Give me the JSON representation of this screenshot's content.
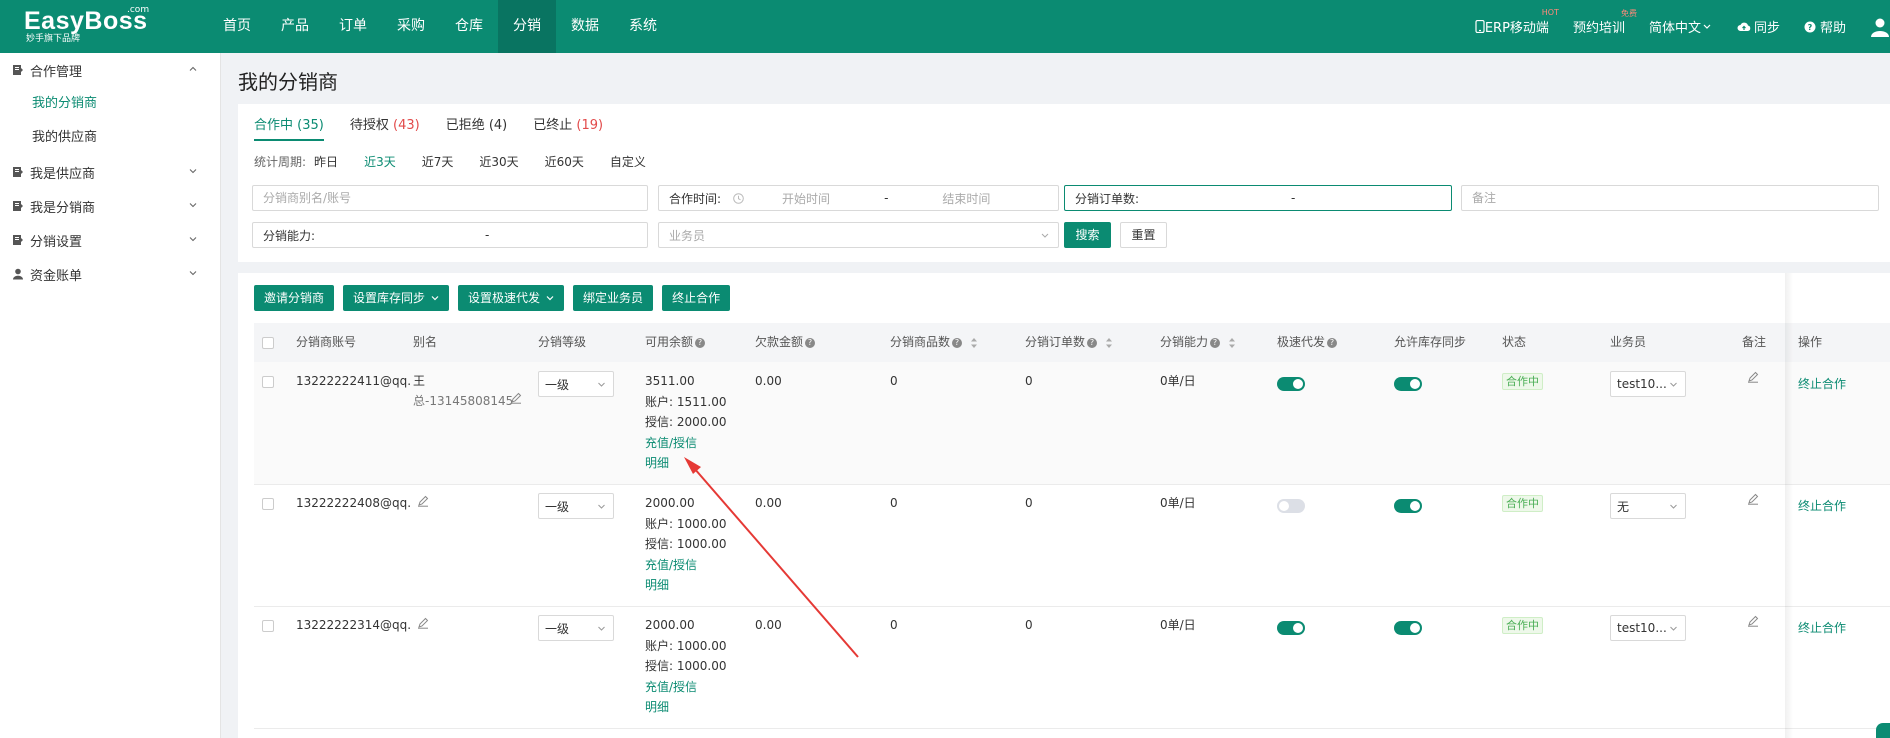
{
  "app": {
    "logo": "EasyBoss",
    "logo_com": ".com",
    "slogan": "妙手旗下品牌",
    "accent": "#0b8b72"
  },
  "nav": [
    "首页",
    "产品",
    "订单",
    "采购",
    "仓库",
    "分销",
    "数据",
    "系统"
  ],
  "nav_active": "分销",
  "topright": {
    "erp": "ERP移动端",
    "hot": "HOT",
    "training": "预约培训",
    "free": "免费",
    "language": "简体中文",
    "sync": "同步",
    "help": "帮助"
  },
  "sidebar": {
    "groups": [
      {
        "label": "合作管理",
        "expanded": true,
        "items": [
          "我的分销商",
          "我的供应商"
        ],
        "active": "我的分销商"
      },
      {
        "label": "我是供应商"
      },
      {
        "label": "我是分销商"
      },
      {
        "label": "分销设置"
      },
      {
        "label": "资金账单"
      }
    ]
  },
  "page_title": "我的分销商",
  "tabs": [
    {
      "label": "合作中",
      "count": "(35)",
      "active": true
    },
    {
      "label": "待授权",
      "count": "(43)"
    },
    {
      "label": "已拒绝",
      "count": "(4)"
    },
    {
      "label": "已终止",
      "count": "(19)"
    }
  ],
  "period": {
    "label": "统计周期:",
    "options": [
      "昨日",
      "近3天",
      "近7天",
      "近30天",
      "近60天",
      "自定义"
    ],
    "active": "近3天"
  },
  "filters": {
    "account_placeholder": "分销商别名/账号",
    "coop_time_label": "合作时间:",
    "start_placeholder": "开始时间",
    "dash": "-",
    "end_placeholder": "结束时间",
    "orders_label": "分销订单数:",
    "note_placeholder": "备注",
    "capacity_label": "分销能力:",
    "salesman_placeholder": "业务员",
    "search": "搜索",
    "reset": "重置"
  },
  "actions": [
    "邀请分销商",
    "设置库存同步",
    "设置极速代发",
    "绑定业务员",
    "终止合作"
  ],
  "columns": {
    "account": "分销商账号",
    "alias": "别名",
    "level": "分销等级",
    "balance": "可用余额",
    "debt": "欠款金额",
    "products": "分销商品数",
    "orders": "分销订单数",
    "capacity": "分销能力",
    "fast": "极速代发",
    "stock_sync": "允许库存同步",
    "status": "状态",
    "salesman": "业务员",
    "note": "备注",
    "op": "操作"
  },
  "rows": [
    {
      "account": "13222222411@qq.",
      "alias1": "王",
      "alias2": "总-13145808145",
      "level": "一级",
      "balance": "3511.00",
      "account_line": "账户:  1511.00",
      "credit_line": "授信:  2000.00",
      "recharge1": "充值/授信",
      "recharge2": "明细",
      "debt": "0.00",
      "products": "0",
      "orders": "0",
      "capacity": "0单/日",
      "fast": true,
      "stock_sync": true,
      "status": "合作中",
      "salesman": "test10...",
      "op": "终止合作"
    },
    {
      "account": "13222222408@qq.",
      "alias1": "",
      "alias2": "",
      "level": "一级",
      "balance": "2000.00",
      "account_line": "账户:  1000.00",
      "credit_line": "授信:  1000.00",
      "recharge1": "充值/授信",
      "recharge2": "明细",
      "debt": "0.00",
      "products": "0",
      "orders": "0",
      "capacity": "0单/日",
      "fast": false,
      "stock_sync": true,
      "status": "合作中",
      "salesman": "无",
      "op": "终止合作"
    },
    {
      "account": "13222222314@qq.",
      "alias1": "",
      "alias2": "",
      "level": "一级",
      "balance": "2000.00",
      "account_line": "账户:  1000.00",
      "credit_line": "授信:  1000.00",
      "recharge1": "充值/授信",
      "recharge2": "明细",
      "debt": "0.00",
      "products": "0",
      "orders": "0",
      "capacity": "0单/日",
      "fast": true,
      "stock_sync": true,
      "status": "合作中",
      "salesman": "test10...",
      "op": "终止合作"
    }
  ],
  "annotation": {
    "color": "#e53935"
  }
}
